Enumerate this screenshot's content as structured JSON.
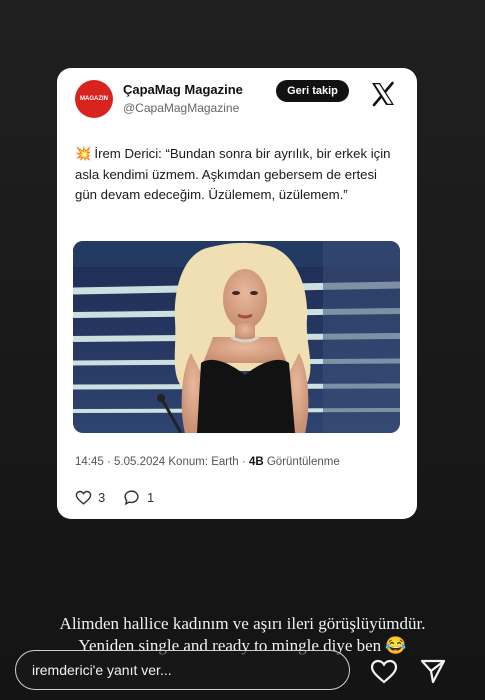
{
  "tweet": {
    "avatar_text": "MAGAZIN",
    "account_name": "ÇapaMag Magazine",
    "handle": "@CapaMagMagazine",
    "follow_label": "Geri takip",
    "emoji": "💥",
    "text": "İrem Derici: “Bundan sonra bir ayrılık, bir erkek için asla kendimi üzmem. Aşkımdan gebersem de ertesi gün devam edeceğim. Üzülemem, üzülemem.”",
    "time": "14:45",
    "date": "5.05.2024",
    "location": "Konum: Earth",
    "views_count": "4B",
    "views_label": "Görüntülenme",
    "likes": "3",
    "replies": "1"
  },
  "story": {
    "caption_line1": "Alimden hallice kadınım ve aşırı ileri görüşlüyümdür.",
    "caption_line2": "Yeniden single and ready to mingle diye ben 😂",
    "reply_placeholder": "iremderici'e yanıt ver..."
  },
  "colors": {
    "avatar_red": "#d9231f",
    "background": "#1c1c1c"
  }
}
